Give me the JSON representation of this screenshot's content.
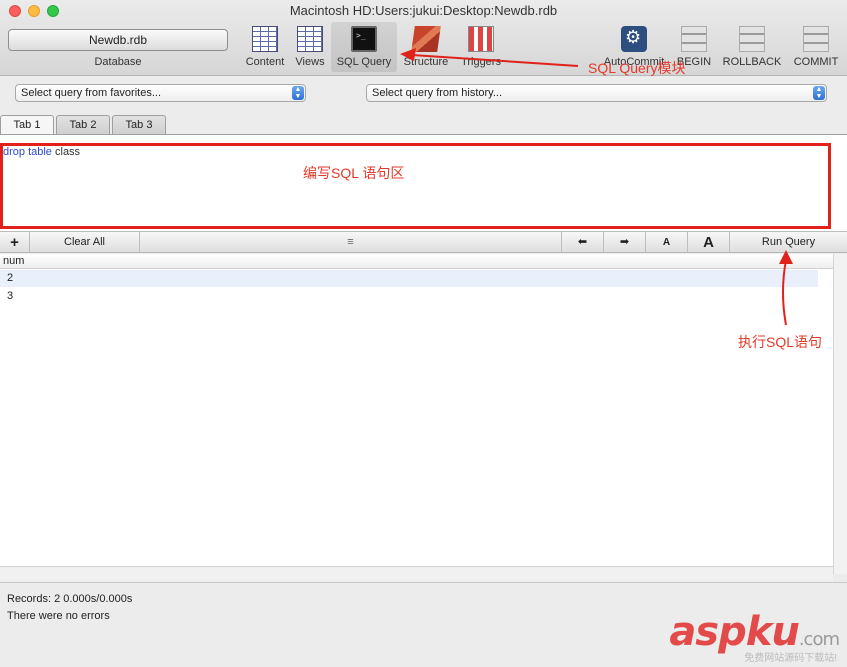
{
  "window": {
    "title": "Macintosh HD:Users:jukui:Desktop:Newdb.rdb"
  },
  "database": {
    "button_label": "Newdb.rdb",
    "label": "Database"
  },
  "toolbar": {
    "content": "Content",
    "views": "Views",
    "sql_query": "SQL Query",
    "structure": "Structure",
    "triggers": "Triggers",
    "autocommit": "AutoCommit",
    "begin": "BEGIN",
    "rollback": "ROLLBACK",
    "commit": "COMMIT"
  },
  "query_selectors": {
    "favorites": "Select query from favorites...",
    "history": "Select query from history..."
  },
  "tabs": [
    {
      "label": "Tab 1"
    },
    {
      "label": "Tab 2"
    },
    {
      "label": "Tab 3"
    }
  ],
  "editor": {
    "keyword": "drop table",
    "rest": " class"
  },
  "result_toolbar": {
    "add": "+",
    "clear_all": "Clear All",
    "handle": "≡",
    "prev": "⬅",
    "next": "➡",
    "font_small": "A",
    "font_large": "A",
    "run_query": "Run Query"
  },
  "results": {
    "column": "num",
    "rows": [
      "2",
      "3"
    ]
  },
  "status": {
    "records": "Records: 2  0.000s/0.000s",
    "message": "There were no errors"
  },
  "annotations": {
    "sql_query_module": "SQL Query模块",
    "edit_area": "编写SQL 语句区",
    "execute": "执行SQL语句"
  },
  "watermark": {
    "brand": "aspku",
    "tld": ".com",
    "sub": "免费网站源码下载站!"
  },
  "colors": {
    "annotation": "#e0221b",
    "keyword": "#2c49d6",
    "selected_row": "#e9f0fb"
  }
}
